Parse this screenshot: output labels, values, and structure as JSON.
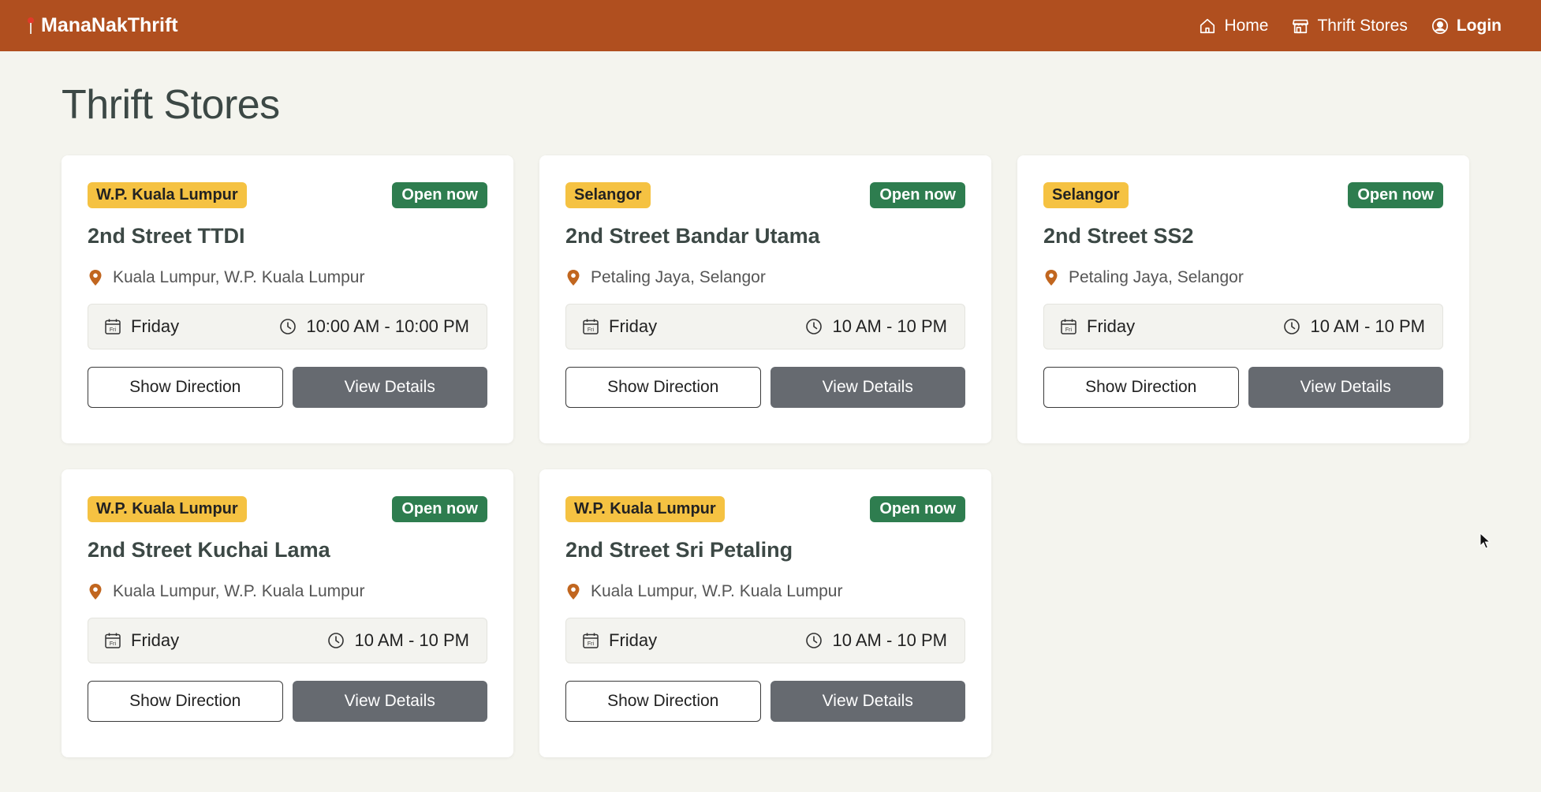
{
  "nav": {
    "brand": "ManaNakThrift",
    "links": [
      {
        "label": "Home",
        "icon": "home-icon"
      },
      {
        "label": "Thrift Stores",
        "icon": "store-icon"
      },
      {
        "label": "Login",
        "icon": "user-circle-icon"
      }
    ]
  },
  "page": {
    "title": "Thrift Stores"
  },
  "colors": {
    "navbar": "#b04f1f",
    "region_badge": "#f5c242",
    "open_badge": "#2e7d4f",
    "view_button": "#666a70"
  },
  "labels": {
    "show_direction": "Show Direction",
    "view_details": "View Details"
  },
  "stores": [
    {
      "region": "W.P. Kuala Lumpur",
      "status": "Open now",
      "name": "2nd Street TTDI",
      "location": "Kuala Lumpur, W.P. Kuala Lumpur",
      "day": "Friday",
      "day_icon_text": "Fri",
      "hours": "10:00 AM - 10:00 PM"
    },
    {
      "region": "Selangor",
      "status": "Open now",
      "name": "2nd Street Bandar Utama",
      "location": "Petaling Jaya, Selangor",
      "day": "Friday",
      "day_icon_text": "Fri",
      "hours": "10 AM - 10 PM"
    },
    {
      "region": "Selangor",
      "status": "Open now",
      "name": "2nd Street SS2",
      "location": "Petaling Jaya, Selangor",
      "day": "Friday",
      "day_icon_text": "Fri",
      "hours": "10 AM - 10 PM"
    },
    {
      "region": "W.P. Kuala Lumpur",
      "status": "Open now",
      "name": "2nd Street Kuchai Lama",
      "location": "Kuala Lumpur, W.P. Kuala Lumpur",
      "day": "Friday",
      "day_icon_text": "Fri",
      "hours": "10 AM - 10 PM"
    },
    {
      "region": "W.P. Kuala Lumpur",
      "status": "Open now",
      "name": "2nd Street Sri Petaling",
      "location": "Kuala Lumpur, W.P. Kuala Lumpur",
      "day": "Friday",
      "day_icon_text": "Fri",
      "hours": "10 AM - 10 PM"
    }
  ]
}
